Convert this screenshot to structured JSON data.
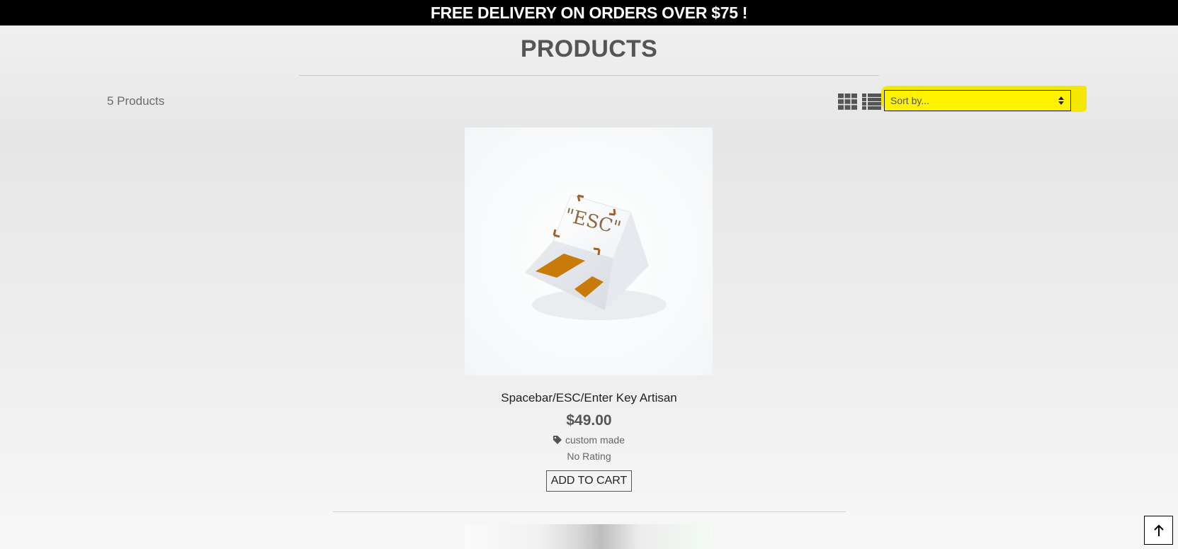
{
  "promo": {
    "text": "FREE DELIVERY ON ORDERS OVER $75 !"
  },
  "page": {
    "title": "PRODUCTS"
  },
  "toolbar": {
    "product_count": "5 Products",
    "sort": {
      "placeholder": "Sort by..."
    },
    "views": [
      "grid-view-icon",
      "list-view-icon"
    ]
  },
  "products": [
    {
      "name": "Spacebar/ESC/Enter Key Artisan",
      "price": "$49.00",
      "tag": "custom made",
      "rating": "No Rating",
      "add_to_cart_label": "ADD TO CART",
      "image_text": "\"ESC\""
    }
  ],
  "colors": {
    "promo_bg": "#000000",
    "highlight": "#f6e700",
    "text": "#555555",
    "key_accent": "#d48a00"
  },
  "icons": {
    "tag": "tag-icon",
    "back_to_top": "arrow-up-icon",
    "sort": "sort-arrows-icon"
  }
}
